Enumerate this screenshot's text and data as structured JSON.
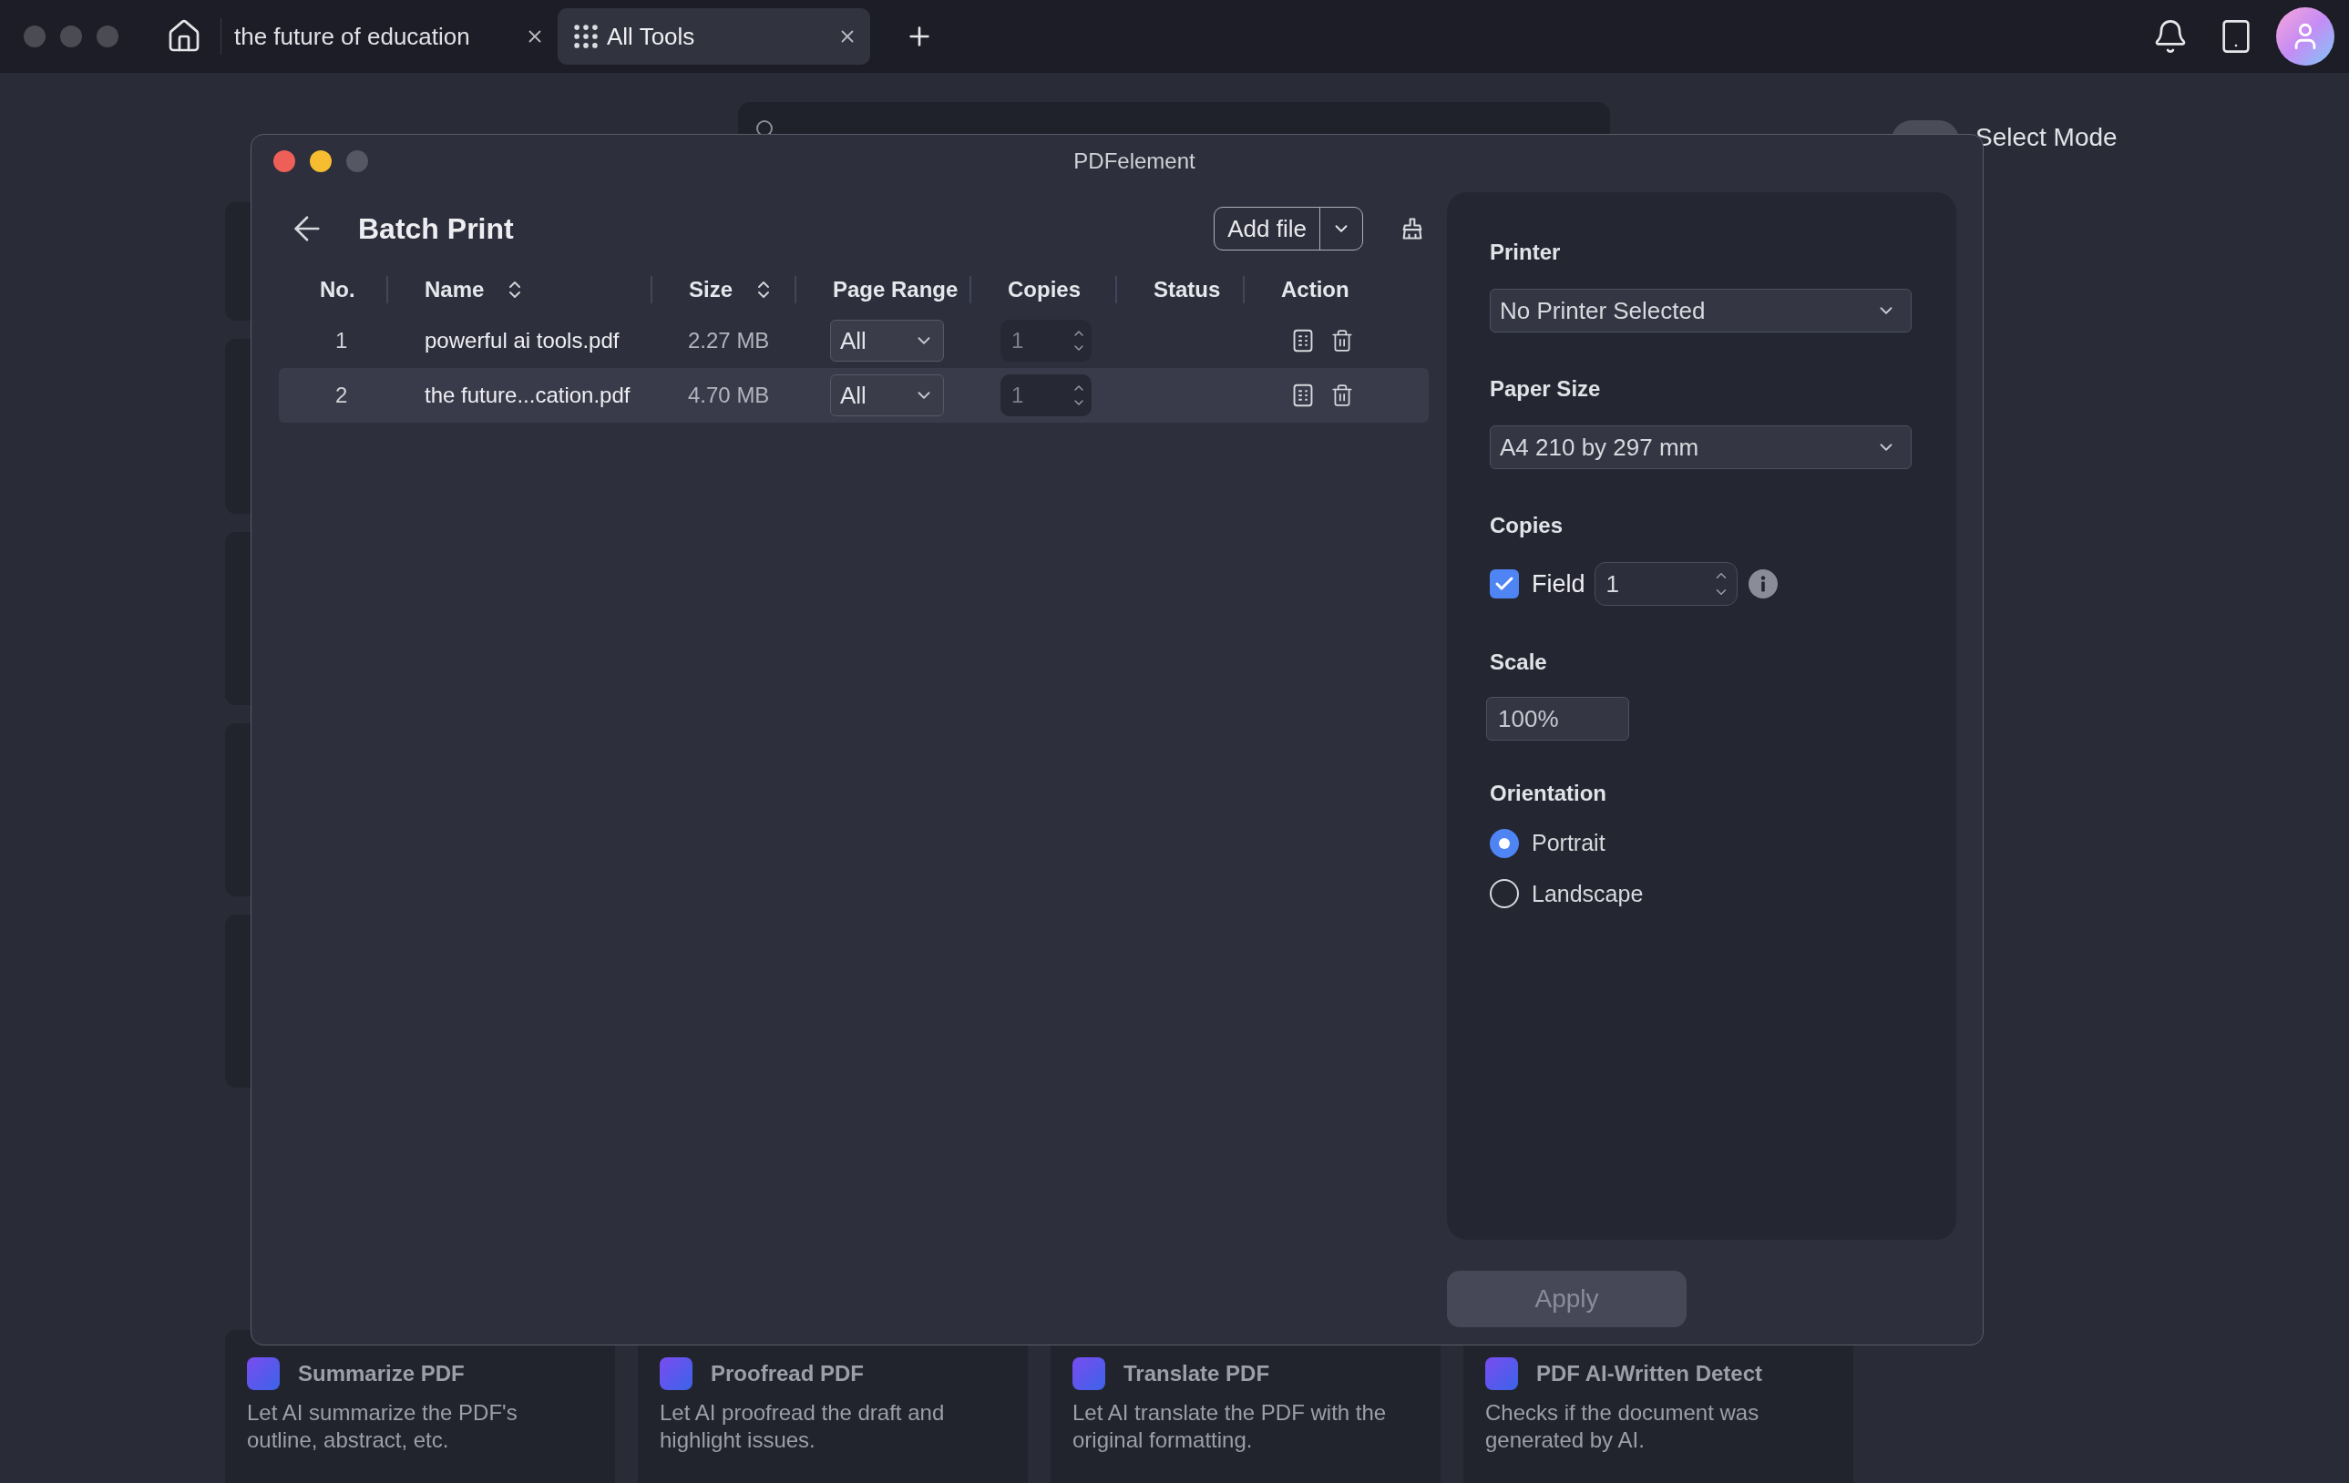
{
  "tabs": [
    {
      "title": "the future of education",
      "selected": false,
      "kind": "document"
    },
    {
      "title": "All Tools",
      "selected": true,
      "kind": "tools"
    }
  ],
  "background": {
    "select_mode": {
      "label": "Select Mode",
      "on": false
    },
    "tool_cards": [
      {
        "title": "Summarize PDF",
        "description": "Let AI summarize the PDF's outline, abstract, etc."
      },
      {
        "title": "Proofread PDF",
        "description": "Let AI proofread the draft and highlight issues."
      },
      {
        "title": "Translate PDF",
        "description": "Let AI translate the PDF with the original formatting."
      },
      {
        "title": "PDF AI-Written Detect",
        "description": "Checks if the document was generated by AI."
      }
    ]
  },
  "dialog": {
    "title": "PDFelement",
    "heading": "Batch Print",
    "add_button": "Add file",
    "columns": [
      {
        "label": "No.",
        "sortable": false
      },
      {
        "label": "Name",
        "sortable": true
      },
      {
        "label": "Size",
        "sortable": true
      },
      {
        "label": "Page Range",
        "sortable": false
      },
      {
        "label": "Copies",
        "sortable": false
      },
      {
        "label": "Status",
        "sortable": false
      },
      {
        "label": "Action",
        "sortable": false
      }
    ],
    "rows": [
      {
        "no": "1",
        "name": "powerful ai tools.pdf",
        "size": "2.27 MB",
        "page_range": "All",
        "copies": "1",
        "highlighted": false
      },
      {
        "no": "2",
        "name": "the future...cation.pdf",
        "size": "4.70 MB",
        "page_range": "All",
        "copies": "1",
        "highlighted": true
      }
    ],
    "settings": {
      "printer": {
        "label": "Printer",
        "value": "No Printer Selected"
      },
      "paper_size": {
        "label": "Paper Size",
        "value": "A4 210 by 297 mm"
      },
      "copies": {
        "label": "Copies",
        "checkbox": {
          "label": "Field",
          "checked": true
        },
        "value": "1"
      },
      "scale": {
        "label": "Scale",
        "value": "100%"
      },
      "orientation": {
        "label": "Orientation",
        "options": [
          {
            "label": "Portrait",
            "selected": true
          },
          {
            "label": "Landscape",
            "selected": false
          }
        ]
      }
    },
    "apply": {
      "label": "Apply",
      "disabled": true
    }
  }
}
